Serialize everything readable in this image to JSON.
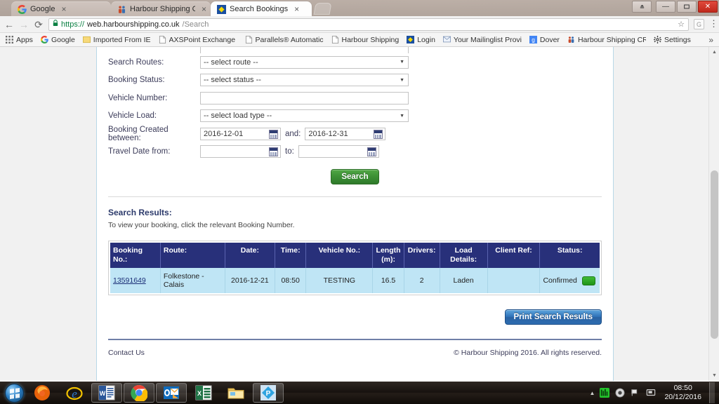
{
  "browser": {
    "tabs": [
      {
        "label": "Google",
        "favicon": "google-icon",
        "active": false
      },
      {
        "label": "Harbour Shipping CRM",
        "favicon": "harbour-crm-icon",
        "active": false
      },
      {
        "label": "Search Bookings",
        "favicon": "harbour-diamond-icon",
        "active": true
      }
    ],
    "tab_close_glyph": "×",
    "nav": {
      "back_glyph": "←",
      "forward_glyph": "→",
      "reload_glyph": "⟳"
    },
    "omnibox": {
      "lock_glyph": "🔒",
      "scheme": "https://",
      "host": "web.harbourshipping.co.uk",
      "path": "/Search",
      "star_glyph": "☆",
      "profile_badge": "G",
      "menu_glyph": "⋮"
    },
    "window_controls": {
      "restore_small": "▲",
      "minimize": "—",
      "maximize": "❐",
      "close": "✕"
    },
    "bookmarks": [
      {
        "label": "Apps",
        "icon": "apps-grid-icon"
      },
      {
        "label": "Google",
        "icon": "google-icon"
      },
      {
        "label": "Imported From IE",
        "icon": "folder-icon"
      },
      {
        "label": "AXSPoint Exchange L",
        "icon": "page-icon"
      },
      {
        "label": "Parallels® Automatic",
        "icon": "page-icon"
      },
      {
        "label": "Harbour Shipping",
        "icon": "page-icon"
      },
      {
        "label": "Login",
        "icon": "harbour-diamond-icon"
      },
      {
        "label": "Your Mailinglist Provi",
        "icon": "mail-icon"
      },
      {
        "label": "Dover",
        "icon": "google-blue-icon"
      },
      {
        "label": "Harbour Shipping CR",
        "icon": "harbour-crm-icon"
      },
      {
        "label": "Settings",
        "icon": "gear-icon"
      }
    ],
    "bookmarks_overflow_glyph": "»"
  },
  "form": {
    "rows": [
      {
        "label": "Search Routes:",
        "type": "select",
        "value": "-- select route --"
      },
      {
        "label": "Booking Status:",
        "type": "select",
        "value": "-- select status --"
      },
      {
        "label": "Vehicle Number:",
        "type": "text",
        "value": ""
      },
      {
        "label": "Vehicle Load:",
        "type": "select",
        "value": "-- select load type --"
      }
    ],
    "created_between": {
      "label": "Booking Created between:",
      "from": "2016-12-01",
      "conjunction": "and:",
      "to": "2016-12-31"
    },
    "travel_date": {
      "label": "Travel Date from:",
      "from": "",
      "conjunction": "to:",
      "to": ""
    },
    "search_button": "Search",
    "caret_glyph": "▼"
  },
  "results": {
    "title": "Search Results:",
    "subtitle": "To view your booking, click the relevant Booking Number.",
    "columns": [
      "Booking No.:",
      "Route:",
      "Date:",
      "Time:",
      "Vehicle No.:",
      "Length (m):",
      "Drivers:",
      "Load Details:",
      "Client Ref:",
      "Status:"
    ],
    "rows": [
      {
        "booking_no": "13591649",
        "route": "Folkestone - Calais",
        "date": "2016-12-21",
        "time": "08:50",
        "vehicle_no": "TESTING",
        "length_m": "16.5",
        "drivers": "2",
        "load_details": "Laden",
        "client_ref": "",
        "status": "Confirmed"
      }
    ],
    "print_button": "Print Search Results",
    "status_chip_color": "#2aa31f"
  },
  "footer": {
    "contact": "Contact Us",
    "copyright": "© Harbour Shipping 2016. All rights reserved."
  },
  "scrollbar": {
    "up_glyph": "▲",
    "down_glyph": "▼"
  },
  "taskbar": {
    "apps": [
      {
        "name": "firefox-icon",
        "running": false
      },
      {
        "name": "internet-explorer-icon",
        "running": false
      },
      {
        "name": "word-icon",
        "running": true
      },
      {
        "name": "chrome-icon",
        "running": true
      },
      {
        "name": "outlook-icon",
        "running": true
      },
      {
        "name": "excel-icon",
        "running": false
      },
      {
        "name": "file-explorer-icon",
        "running": false
      },
      {
        "name": "parallels-icon",
        "running": true
      }
    ],
    "tray": {
      "expand_glyph": "▲",
      "icons": [
        "network-monitor-icon",
        "media-icon",
        "flag-icon",
        "display-icon"
      ],
      "time": "08:50",
      "date": "20/12/2016"
    }
  }
}
